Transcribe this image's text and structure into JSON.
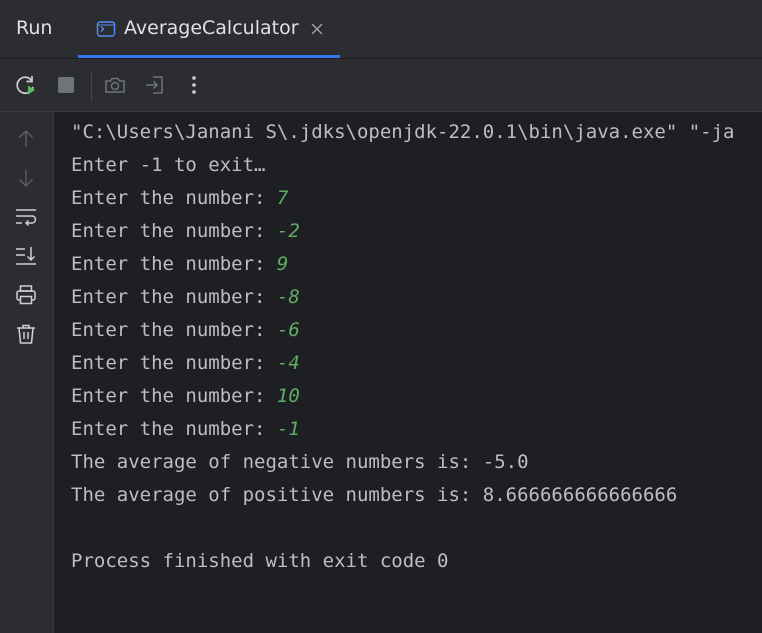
{
  "header": {
    "run_title": "Run",
    "tab_label": "AverageCalculator"
  },
  "toolbar": {
    "buttons": [
      "rerun-icon",
      "stop-icon",
      "camera-icon",
      "exit-icon",
      "more-vertical-icon"
    ]
  },
  "gutter": {
    "buttons": [
      "arrow-up-icon",
      "arrow-down-icon",
      "soft-wrap-icon",
      "scroll-to-end-icon",
      "print-icon",
      "trash-icon"
    ]
  },
  "console": {
    "command_line": "\"C:\\Users\\Janani S\\.jdks\\openjdk-22.0.1\\bin\\java.exe\" \"-ja",
    "intro": "Enter -1 to exit…",
    "prompt": "Enter the number: ",
    "inputs": [
      "7",
      "-2",
      "9",
      "-8",
      "-6",
      "-4",
      "10",
      "-1"
    ],
    "neg_avg": "The average of negative numbers is: -5.0",
    "pos_avg": "The average of positive numbers is: 8.666666666666666",
    "exit_msg": "Process finished with exit code 0"
  },
  "colors": {
    "accent": "#3574f0",
    "input_green": "#5fad65",
    "text": "#bcbec4",
    "background": "#1e1f22",
    "panel": "#2b2d30"
  }
}
